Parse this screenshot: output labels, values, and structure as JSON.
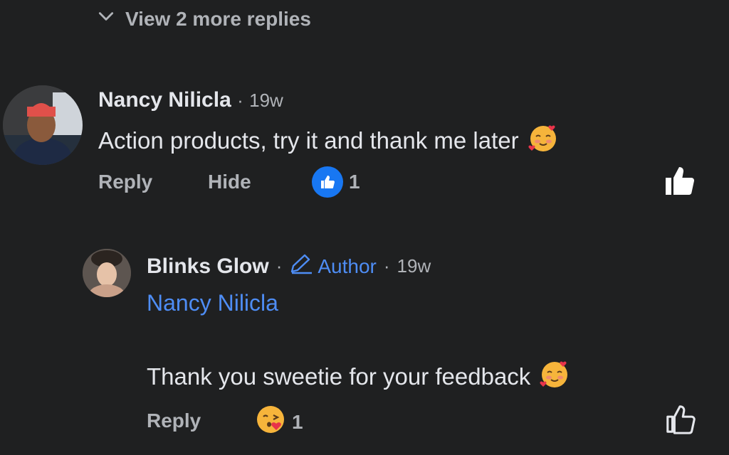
{
  "thread": {
    "view_more_label": "View 2 more replies"
  },
  "comment": {
    "author": "Nancy Nilicla",
    "separator": "·",
    "time": "19w",
    "text": "Action products, try it and thank me later",
    "actions": {
      "reply": "Reply",
      "hide": "Hide"
    },
    "reaction_count": "1"
  },
  "reply": {
    "author": "Blinks Glow",
    "separator": "·",
    "author_badge": "Author",
    "separator2": "·",
    "time": "19w",
    "mention": "Nancy Nilicla",
    "text": "Thank you sweetie for your feedback",
    "actions": {
      "reply": "Reply"
    },
    "reaction_count": "1"
  },
  "colors": {
    "background": "#1f2021",
    "link_blue": "#4e8df5",
    "like_blue": "#1877f2",
    "muted_text": "#b0b3b8",
    "main_text": "#e4e6eb"
  },
  "icons": {
    "view_more": "chevron-down-icon",
    "comment_reaction": "like-icon",
    "reply_reaction": "blowing-kiss-emoji",
    "comment_like": "thumbs-up-filled-icon",
    "reply_like": "thumbs-up-outline-icon",
    "author_badge": "pencil-icon",
    "text_emoji": "smiling-hearts-emoji"
  }
}
